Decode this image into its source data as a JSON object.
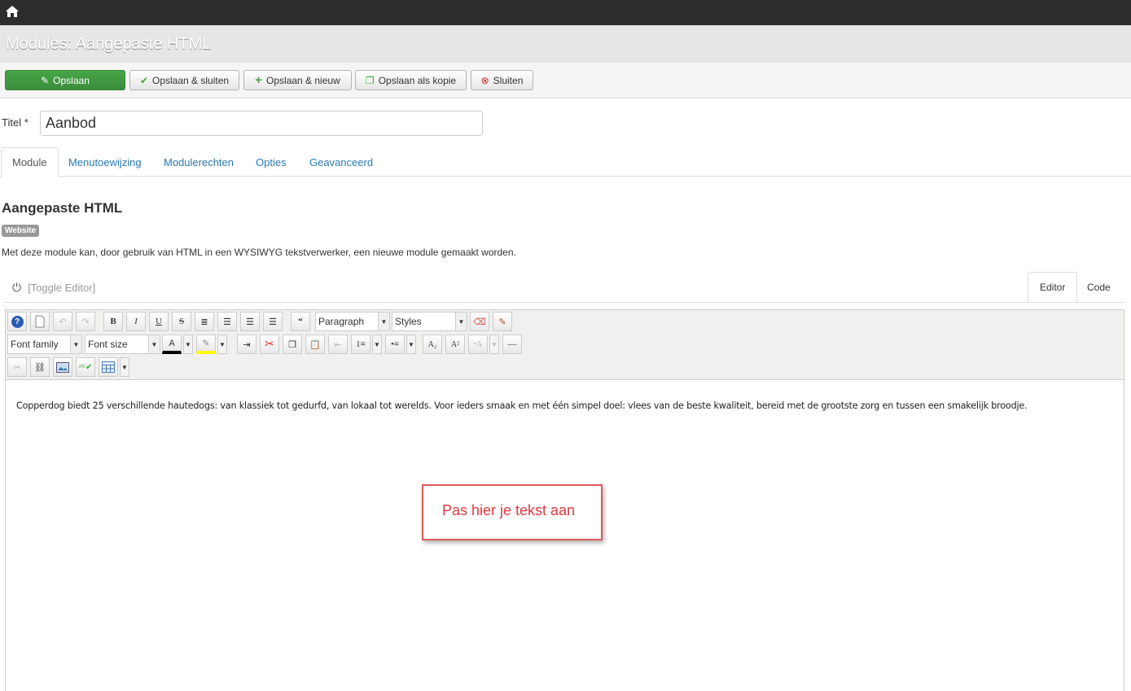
{
  "header": {
    "title": "Modules: Aangepaste HTML"
  },
  "toolbar": {
    "save": "Opslaan",
    "save_close": "Opslaan & sluiten",
    "save_new": "Opslaan & nieuw",
    "save_copy": "Opslaan als kopie",
    "close": "Sluiten"
  },
  "form": {
    "title_label": "Titel *",
    "title_value": "Aanbod"
  },
  "tabs": [
    "Module",
    "Menutoewijzing",
    "Modulerechten",
    "Opties",
    "Geavanceerd"
  ],
  "module": {
    "heading": "Aangepaste HTML",
    "badge": "Website",
    "description": "Met deze module kan, door gebruik van HTML in een WYSIWYG tekstverwerker, een nieuwe module gemaakt worden."
  },
  "editor": {
    "toggle": "[Toggle Editor]",
    "tab_editor": "Editor",
    "tab_code": "Code",
    "format_select": "Paragraph",
    "styles_select": "Styles",
    "font_family": "Font family",
    "font_size": "Font size",
    "content": "Copperdog biedt 25 verschillende hautedogs: van klassiek tot gedurfd, van lokaal tot werelds. Voor ieders smaak en met één simpel doel: vlees van de beste kwaliteit, bereid met de grootste zorg en tussen een smakelijk broodje."
  },
  "annotation": {
    "text": "Pas hier je tekst aan",
    "color": "#e0393e"
  },
  "colors": {
    "success": "#46a546",
    "link": "#2a7ab0",
    "topbar": "#2d2d2d"
  }
}
